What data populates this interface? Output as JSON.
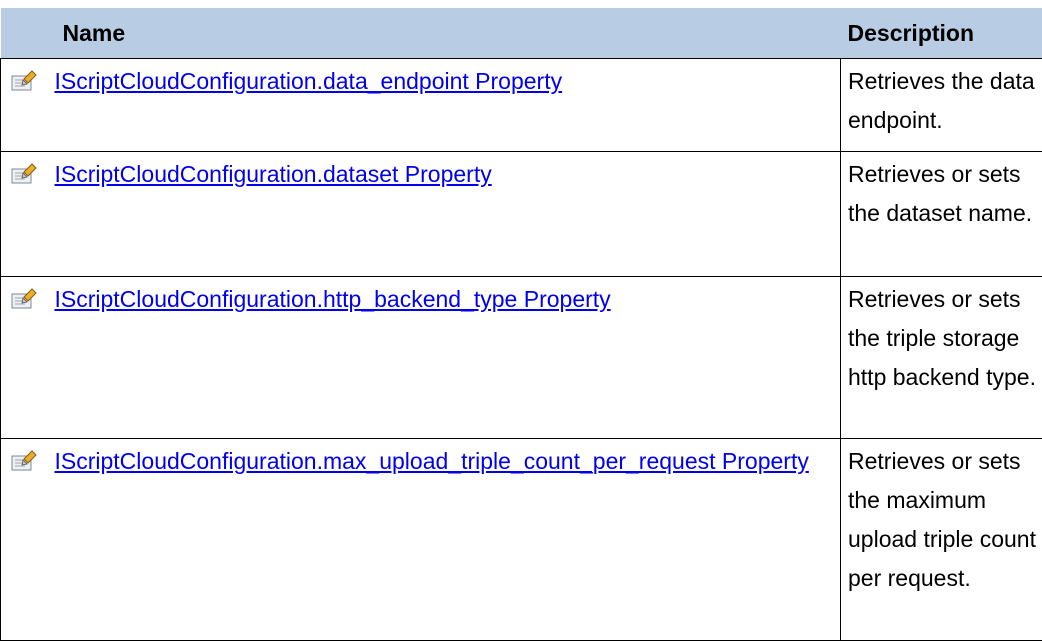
{
  "table": {
    "headers": {
      "icon": "",
      "name": "Name",
      "description": "Description"
    },
    "rows": [
      {
        "icon": "property-icon",
        "name": "IScriptCloudConfiguration.data_endpoint Property",
        "description": "Retrieves the data endpoint."
      },
      {
        "icon": "property-icon",
        "name": "IScriptCloudConfiguration.dataset Property",
        "description": "Retrieves or sets the dataset name."
      },
      {
        "icon": "property-icon",
        "name": "IScriptCloudConfiguration.http_backend_type Property",
        "description": "Retrieves or sets the triple storage http backend type."
      },
      {
        "icon": "property-icon",
        "name": "IScriptCloudConfiguration.max_upload_triple_count_per_request Property",
        "description": "Retrieves or sets the maximum upload triple count per request."
      }
    ]
  },
  "colors": {
    "header_bg": "#b8cce4",
    "link": "#0000ee",
    "border": "#000000"
  }
}
